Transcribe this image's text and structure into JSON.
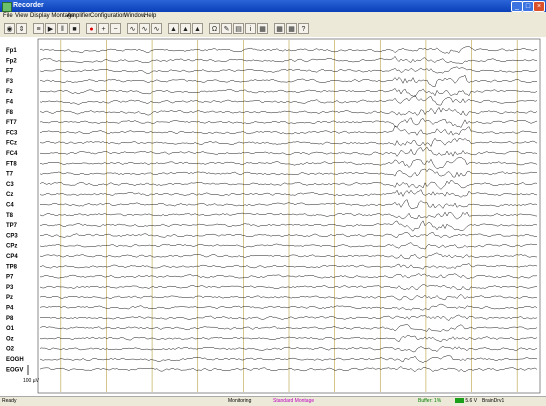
{
  "window": {
    "title": "Recorder"
  },
  "menu": [
    "File",
    "View",
    "Display Montage",
    "Amplifier",
    "Configuration",
    "Window",
    "Help"
  ],
  "toolbar": {
    "buttons": [
      "eye-icon",
      "up-down-icon",
      "settings-icon",
      "play-icon",
      "pause-icon",
      "stop-icon",
      "record-icon",
      "zoom-in-icon",
      "zoom-out-icon",
      "waveform-icon",
      "waveform-icon",
      "waveform-icon",
      "marker-icon",
      "marker-icon",
      "marker-icon",
      "impedance-icon",
      "pen-icon",
      "note-icon",
      "info-icon",
      "montage-icon",
      "montage-icon",
      "montage-icon",
      "help-icon"
    ]
  },
  "chart_data": {
    "type": "line",
    "channels": [
      "Fp1",
      "Fp2",
      "F7",
      "F3",
      "Fz",
      "F4",
      "F8",
      "FT7",
      "FC3",
      "FCz",
      "FC4",
      "FT8",
      "T7",
      "C3",
      "Cz",
      "C4",
      "T8",
      "TP7",
      "CP3",
      "CPz",
      "CP4",
      "TP8",
      "P7",
      "P3",
      "Pz",
      "P4",
      "P8",
      "O1",
      "Oz",
      "O2",
      "EOGH",
      "EOGV"
    ],
    "scale_label": "100 µV",
    "markers": [
      "1",
      "2",
      "3",
      "4",
      "5",
      "6",
      "7",
      "8",
      "9",
      "10",
      "11"
    ],
    "artifact_region": [
      0.71,
      0.86
    ]
  },
  "status": {
    "left": "Ready",
    "mode": "Monitoring",
    "montage": "Standard Montage",
    "buffer": "Buffer: 1%",
    "indicator": "5.6 V",
    "device": "BrainDrv1"
  },
  "colors": {
    "trace": "#000000",
    "marker": "#b8a040",
    "montage": "#c000c0",
    "buffer": "#008000"
  }
}
